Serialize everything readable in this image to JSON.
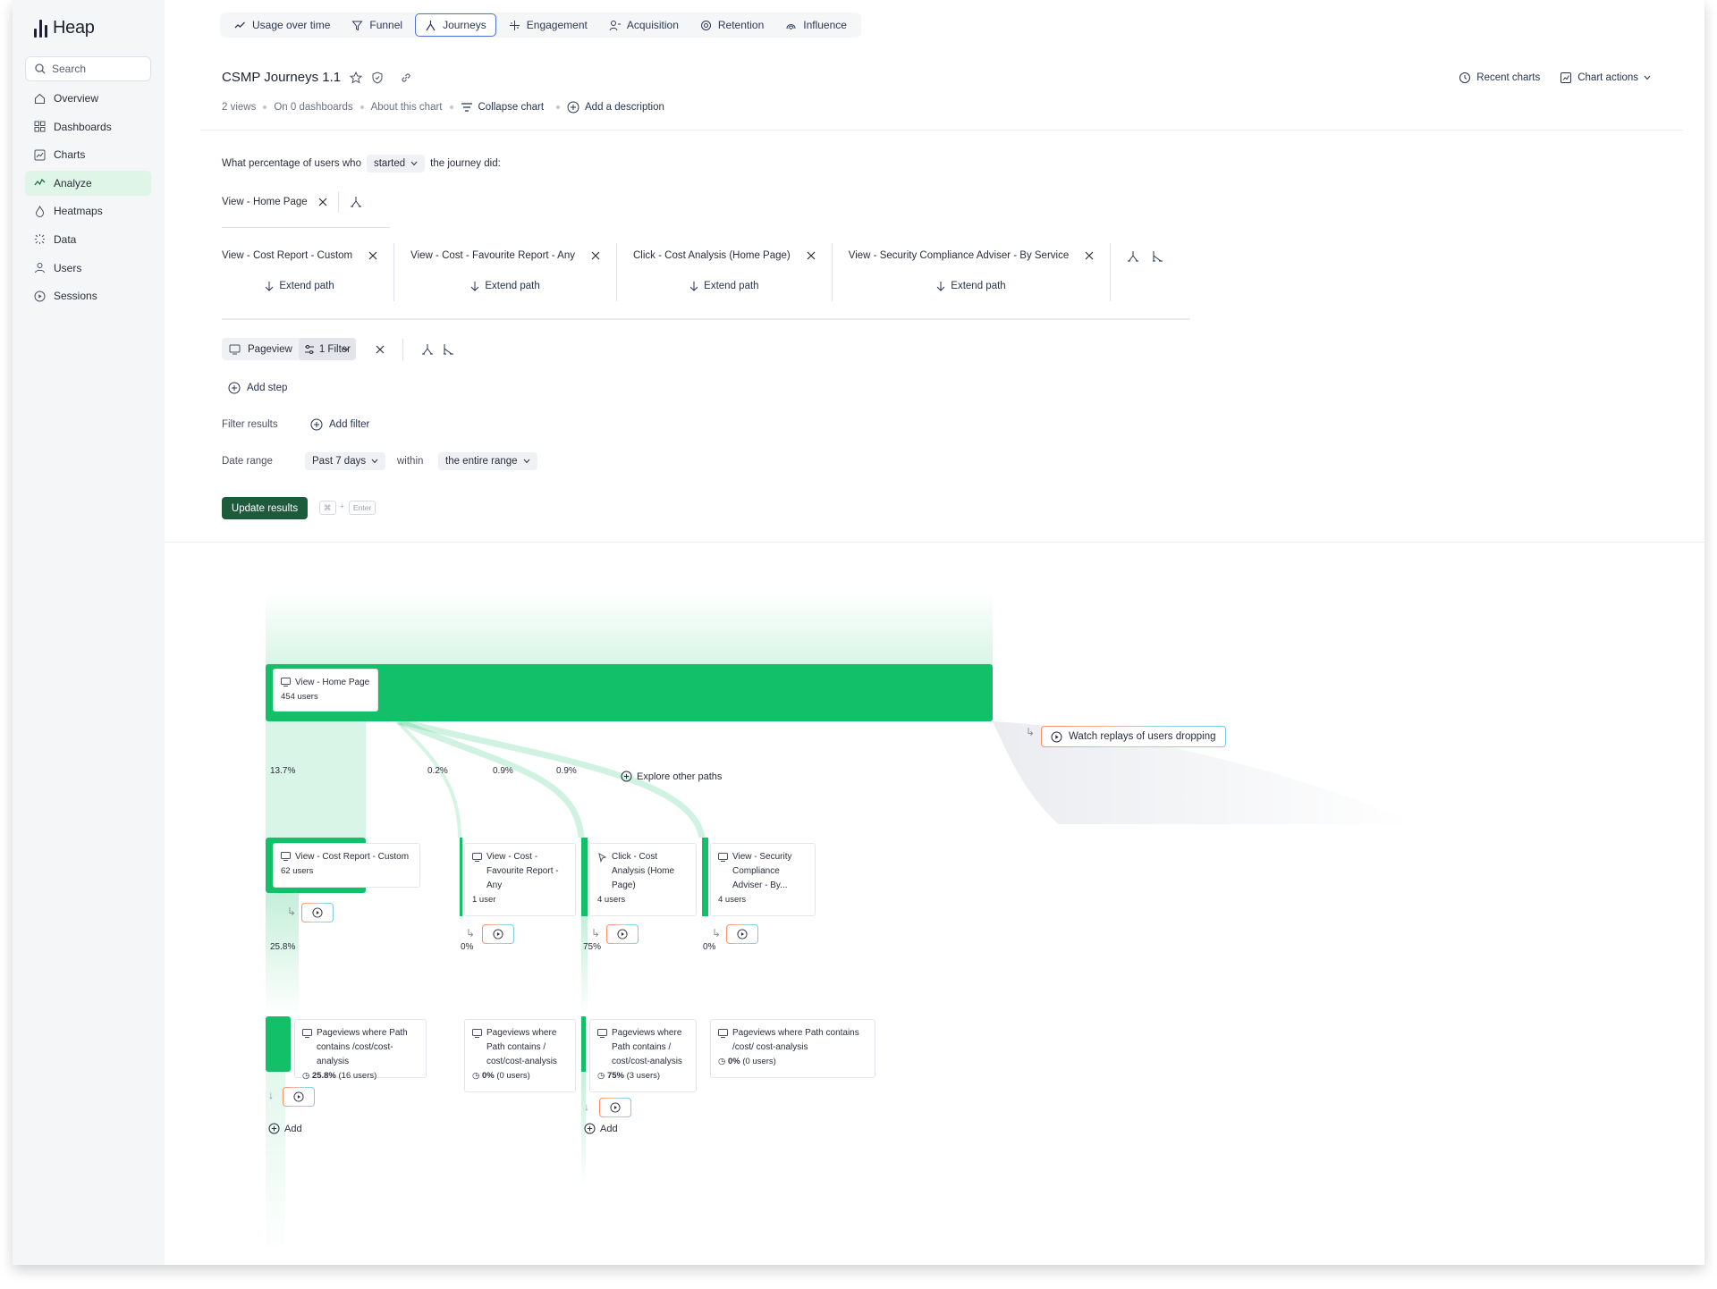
{
  "app": {
    "name": "Heap"
  },
  "sidebar": {
    "search_placeholder": "Search",
    "items": [
      {
        "label": "Overview",
        "icon": "home-icon"
      },
      {
        "label": "Dashboards",
        "icon": "grid-icon"
      },
      {
        "label": "Charts",
        "icon": "chart-icon"
      },
      {
        "label": "Analyze",
        "icon": "analyze-icon",
        "active": true
      },
      {
        "label": "Heatmaps",
        "icon": "flame-icon"
      },
      {
        "label": "Data",
        "icon": "data-icon"
      },
      {
        "label": "Users",
        "icon": "users-icon"
      },
      {
        "label": "Sessions",
        "icon": "play-icon"
      }
    ]
  },
  "tabs": [
    {
      "label": "Usage over time",
      "icon": "trend-icon"
    },
    {
      "label": "Funnel",
      "icon": "funnel-icon"
    },
    {
      "label": "Journeys",
      "icon": "journey-icon",
      "active": true
    },
    {
      "label": "Engagement",
      "icon": "engagement-icon"
    },
    {
      "label": "Acquisition",
      "icon": "acquisition-icon"
    },
    {
      "label": "Retention",
      "icon": "retention-icon"
    },
    {
      "label": "Influence",
      "icon": "influence-icon"
    }
  ],
  "header": {
    "title": "CSMP Journeys 1.1",
    "views": "2 views",
    "dashboards": "On 0 dashboards",
    "about": "About this chart",
    "collapse": "Collapse chart",
    "add_description": "Add a description",
    "recent_charts": "Recent charts",
    "chart_actions": "Chart actions"
  },
  "query": {
    "prefix": "What percentage of users who",
    "mode": "started",
    "suffix": "the journey did:",
    "first_step": "View - Home Page",
    "paths": [
      {
        "label": "View - Cost Report - Custom"
      },
      {
        "label": "View - Cost - Favourite Report - Any"
      },
      {
        "label": "Click - Cost Analysis (Home Page)"
      },
      {
        "label": "View - Security Compliance Adviser - By Service"
      }
    ],
    "extend_label": "Extend path",
    "event_type": "Pageview",
    "filter_label": "1 Filter",
    "add_step": "Add step",
    "filter_results": "Filter results",
    "add_filter": "Add filter",
    "date_range_label": "Date range",
    "date_range": "Past 7 days",
    "within": "within",
    "within_value": "the entire range",
    "update": "Update results",
    "kbd_cmd": "⌘",
    "kbd_plus": "+",
    "kbd_enter": "Enter"
  },
  "chart_data": {
    "type": "sankey",
    "root": {
      "label": "View - Home Page",
      "users": "454 users"
    },
    "watch_replays": "Watch replays of users dropping",
    "explore": "Explore other paths",
    "level1": [
      {
        "pct": "13.7%",
        "label": "View - Cost Report - Custom",
        "users": "62 users",
        "next_pct": "25.8%"
      },
      {
        "pct": "0.2%",
        "label": "View - Cost - Favourite Report - Any",
        "users": "1 user",
        "next_pct": "0%"
      },
      {
        "pct": "0.9%",
        "label": "Click - Cost Analysis (Home Page)",
        "users": "4 users",
        "next_pct": "75%"
      },
      {
        "pct": "0.9%",
        "label": "View - Security Compliance Adviser - By...",
        "users": "4 users",
        "next_pct": "0%"
      }
    ],
    "level2": [
      {
        "label": "Pageviews where Path contains /cost/cost-analysis",
        "pct": "25.8%",
        "users": "(16 users)"
      },
      {
        "label": "Pageviews where Path contains / cost/cost-analysis",
        "pct": "0%",
        "users": "(0 users)"
      },
      {
        "label": "Pageviews where Path contains / cost/cost-analysis",
        "pct": "75%",
        "users": "(3 users)"
      },
      {
        "label": "Pageviews where Path contains /cost/ cost-analysis",
        "pct": "0%",
        "users": "(0 users)"
      }
    ],
    "add_label": "Add"
  },
  "colors": {
    "accent": "#12c06a",
    "primary_button": "#1e5b3c",
    "active_tab_border": "#4d6fd6"
  }
}
